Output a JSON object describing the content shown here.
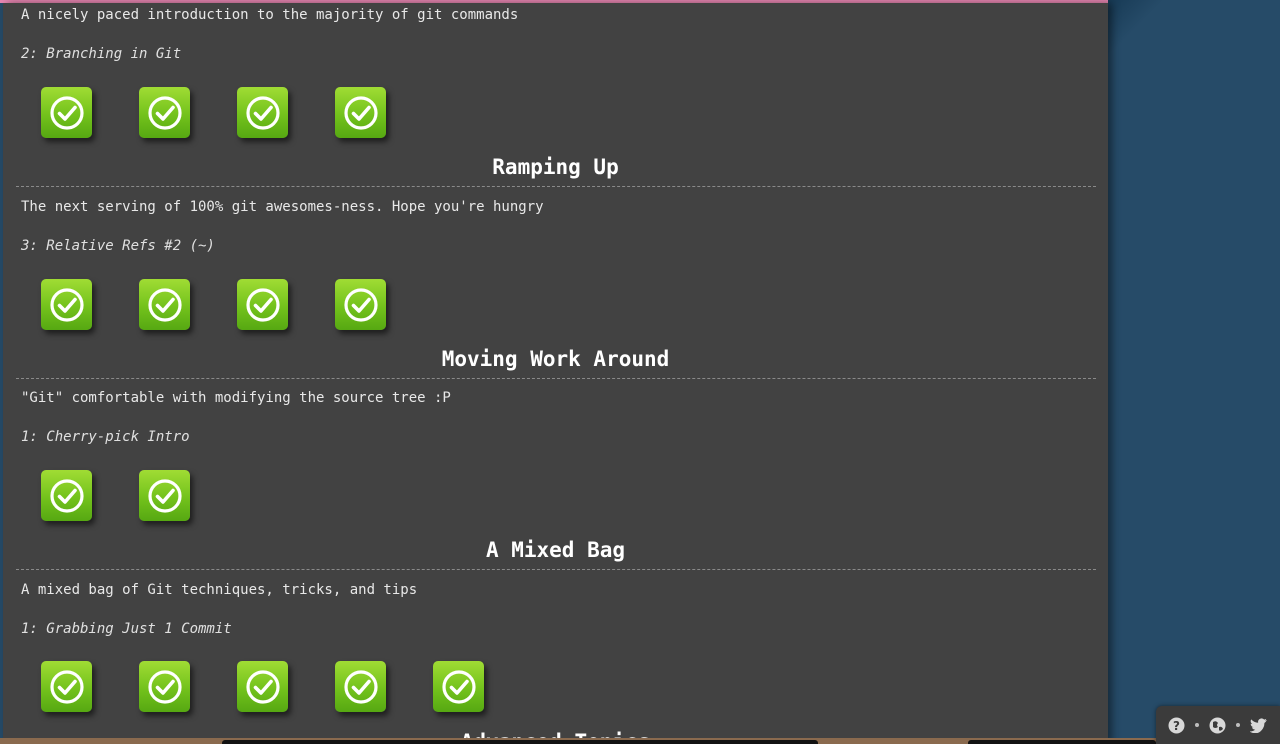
{
  "sections": [
    {
      "id": "intro-sequence",
      "title": "",
      "description": "A nicely paced introduction to the majority of git commands",
      "current_level": "2: Branching in Git",
      "levels_completed": 4,
      "levels_total": 4
    },
    {
      "id": "ramping-up",
      "title": "Ramping Up",
      "description": "The next serving of 100% git awesomes-ness. Hope you're hungry",
      "current_level": "3: Relative Refs #2 (~)",
      "levels_completed": 4,
      "levels_total": 4
    },
    {
      "id": "moving-work-around",
      "title": "Moving Work Around",
      "description": "\"Git\" comfortable with modifying the source tree :P",
      "current_level": "1: Cherry-pick Intro",
      "levels_completed": 2,
      "levels_total": 2
    },
    {
      "id": "mixed-bag",
      "title": "A Mixed Bag",
      "description": "A mixed bag of Git techniques, tricks, and tips",
      "current_level": "1: Grabbing Just 1 Commit",
      "levels_completed": 5,
      "levels_total": 5
    },
    {
      "id": "advanced-topics",
      "title": "Advanced Topics"
    }
  ],
  "icons": {
    "level_icon": "checkmark-circle-icon",
    "tray": [
      "help-icon",
      "globe-icon",
      "twitter-icon"
    ]
  },
  "colors": {
    "dialog_bg": "#424242",
    "backdrop": "#264b68",
    "level_green": "#73c21c",
    "accent_line": "#e887b2"
  }
}
